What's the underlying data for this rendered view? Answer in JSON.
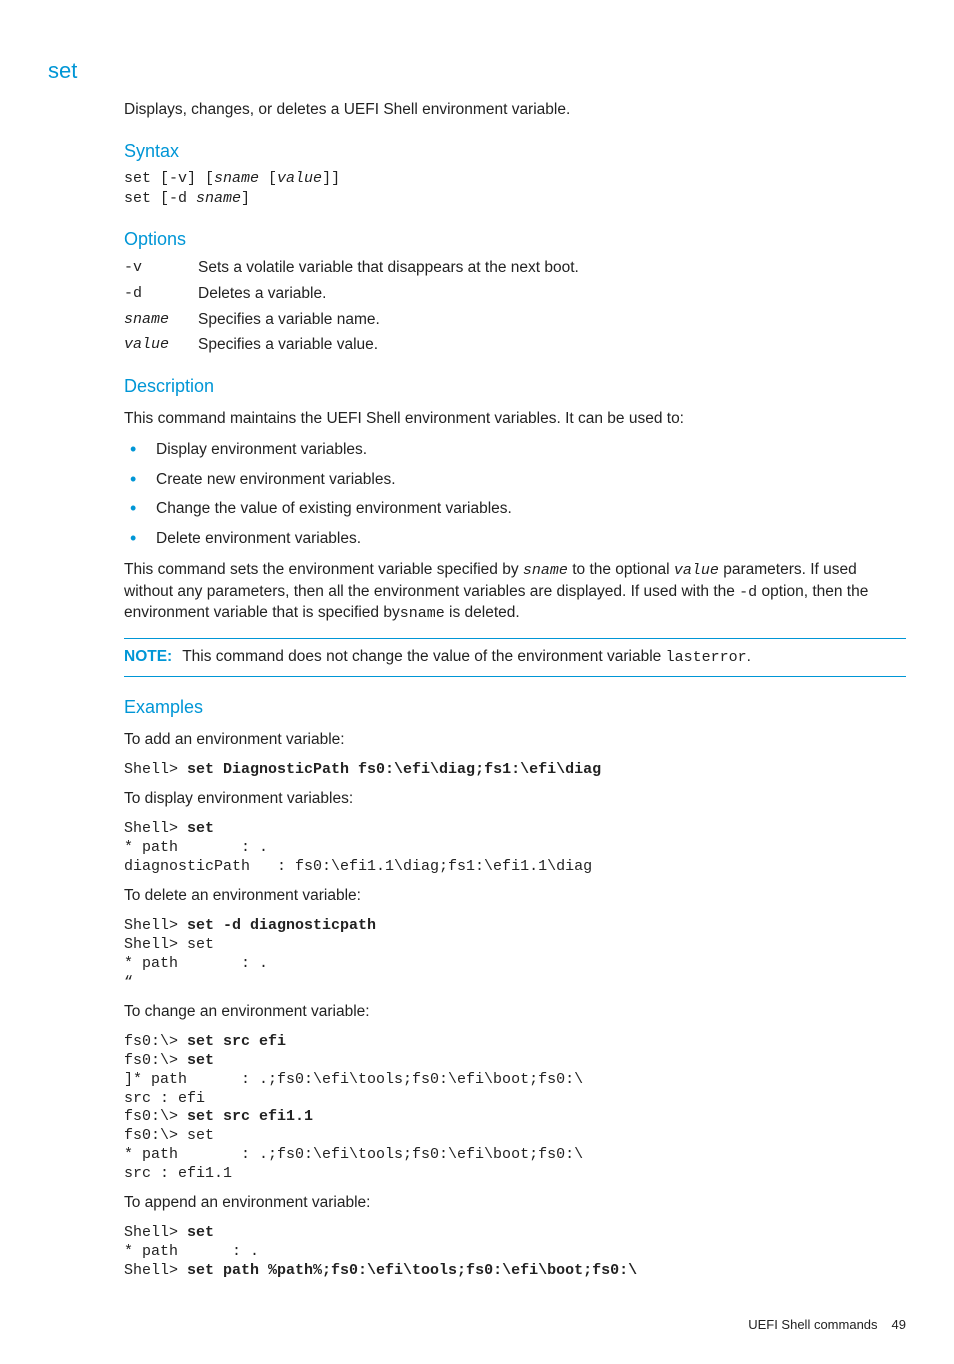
{
  "title": "set",
  "intro": "Displays, changes, or deletes a UEFI Shell environment variable.",
  "syntax_h": "Syntax",
  "syntax1_a": "set [-v] [",
  "syntax1_b": "sname",
  "syntax1_c": " [",
  "syntax1_d": "value",
  "syntax1_e": "]]",
  "syntax2_a": "set [-d ",
  "syntax2_b": "sname",
  "syntax2_c": "]",
  "options_h": "Options",
  "options": [
    {
      "term": "-v",
      "ital": false,
      "desc": "Sets a volatile variable that disappears at the next boot."
    },
    {
      "term": "-d",
      "ital": false,
      "desc": "Deletes a variable."
    },
    {
      "term": "sname",
      "ital": true,
      "desc": "Specifies a variable name."
    },
    {
      "term": "value",
      "ital": true,
      "desc": "Specifies a variable value."
    }
  ],
  "description_h": "Description",
  "desc_p1": "This command maintains the UEFI Shell environment variables. It can be used to:",
  "desc_bullets": [
    "Display environment variables.",
    "Create new environment variables.",
    "Change the value of existing environment variables.",
    "Delete environment variables."
  ],
  "desc_p2_a": "This command sets the environment variable specified by ",
  "desc_p2_b": "sname",
  "desc_p2_c": " to the optional ",
  "desc_p2_d": " value",
  "desc_p2_e": " parameters. If used without any parameters, then all the environment variables are displayed. If used with the ",
  "desc_p2_f": "-d",
  "desc_p2_g": " option, then the environment variable that is specified by",
  "desc_p2_h": "sname",
  "desc_p2_i": " is deleted.",
  "note_label": "NOTE:",
  "note_a": "This command does not change the value of the environment variable ",
  "note_b": "lasterror",
  "note_c": ".",
  "examples_h": "Examples",
  "ex1_label": "To add an environment variable:",
  "ex1_p": "Shell> ",
  "ex1_cmd": "set DiagnosticPath fs0:\\efi\\diag;fs1:\\efi\\diag",
  "ex2_label": "To display environment variables:",
  "ex2_p": "Shell> ",
  "ex2_cmd": "set",
  "ex2_out": "* path       : .\ndiagnosticPath   : fs0:\\efi1.1\\diag;fs1:\\efi1.1\\diag",
  "ex3_label": "To delete an environment variable:",
  "ex3_p": "Shell> ",
  "ex3_cmd": "set -d diagnosticpath",
  "ex3_out": "Shell> set\n* path       : .\n“",
  "ex4_label": "To change an environment variable:",
  "ex4_l1_p": "fs0:\\> ",
  "ex4_l1_cmd": "set src efi",
  "ex4_l2_p": "fs0:\\> ",
  "ex4_l2_cmd": "set",
  "ex4_l3": "]* path      : .;fs0:\\efi\\tools;fs0:\\efi\\boot;fs0:\\",
  "ex4_l4": "src : efi",
  "ex4_l5_p": "fs0:\\> ",
  "ex4_l5_cmd": "set src efi1.1",
  "ex4_l6": "fs0:\\> set",
  "ex4_l7": "* path       : .;fs0:\\efi\\tools;fs0:\\efi\\boot;fs0:\\",
  "ex4_l8": "src : efi1.1",
  "ex5_label": "To append an environment variable:",
  "ex5_p": "Shell> ",
  "ex5_cmd": "set",
  "ex5_out": "* path      : .",
  "ex5_p2": "Shell> ",
  "ex5_cmd2": "set path %path%;fs0:\\efi\\tools;fs0:\\efi\\boot;fs0:\\",
  "footer_label": "UEFI Shell commands",
  "footer_page": "49"
}
